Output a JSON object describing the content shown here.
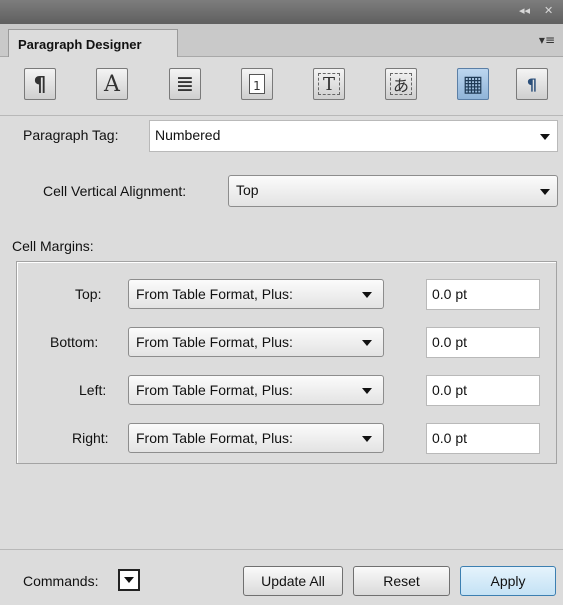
{
  "window": {
    "collapse_glyph": "◂◂",
    "close_glyph": "✕"
  },
  "tab": {
    "title": "Paragraph Designer",
    "menu_glyph": "▾≡"
  },
  "toolbar": {
    "icons": [
      {
        "name": "basic-properties-icon",
        "glyph": "¶"
      },
      {
        "name": "default-font-icon",
        "glyph": "A"
      },
      {
        "name": "pagination-icon",
        "glyph": "≣"
      },
      {
        "name": "numbering-icon",
        "glyph": "1"
      },
      {
        "name": "advanced-icon",
        "glyph": "T"
      },
      {
        "name": "asian-icon",
        "glyph": "あ"
      },
      {
        "name": "table-cell-icon",
        "glyph": "▦"
      },
      {
        "name": "direction-icon",
        "glyph": "¶"
      }
    ],
    "active_index": 6
  },
  "paragraph_tag": {
    "label": "Paragraph Tag:",
    "value": "Numbered"
  },
  "cell_vertical_alignment": {
    "label": "Cell Vertical Alignment:",
    "value": "Top"
  },
  "cell_margins": {
    "label": "Cell Margins:",
    "rows": [
      {
        "label": "Top:",
        "mode": "From Table Format, Plus:",
        "value": "0.0 pt"
      },
      {
        "label": "Bottom:",
        "mode": "From Table Format, Plus:",
        "value": "0.0 pt"
      },
      {
        "label": "Left:",
        "mode": "From Table Format, Plus:",
        "value": "0.0 pt"
      },
      {
        "label": "Right:",
        "mode": "From Table Format, Plus:",
        "value": "0.0 pt"
      }
    ]
  },
  "footer": {
    "commands_label": "Commands:",
    "update_all_label": "Update All",
    "reset_label": "Reset",
    "apply_label": "Apply"
  }
}
